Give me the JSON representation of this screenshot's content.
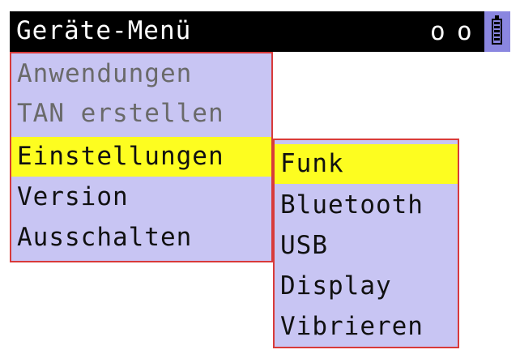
{
  "title": "Geräte-Menü",
  "status": {
    "indicator_1": "o",
    "indicator_2": "o",
    "battery_icon": "battery-icon"
  },
  "colors": {
    "title_bar": "#000000",
    "menu_background": "#c8c5f3",
    "menu_border": "#d83a3a",
    "selection": "#fdfd20",
    "disabled_text": "#6a6a6a",
    "battery_background": "#8a86e0"
  },
  "main_menu": {
    "items": [
      {
        "label": "Anwendungen",
        "state": "disabled"
      },
      {
        "label": "TAN erstellen",
        "state": "disabled"
      },
      {
        "label": "Einstellungen",
        "state": "selected"
      },
      {
        "label": "Version",
        "state": "normal"
      },
      {
        "label": "Ausschalten",
        "state": "normal"
      }
    ]
  },
  "sub_menu": {
    "items": [
      {
        "label": "Funk",
        "state": "selected"
      },
      {
        "label": "Bluetooth",
        "state": "normal"
      },
      {
        "label": "USB",
        "state": "normal"
      },
      {
        "label": "Display",
        "state": "normal"
      },
      {
        "label": "Vibrieren",
        "state": "normal"
      }
    ]
  }
}
